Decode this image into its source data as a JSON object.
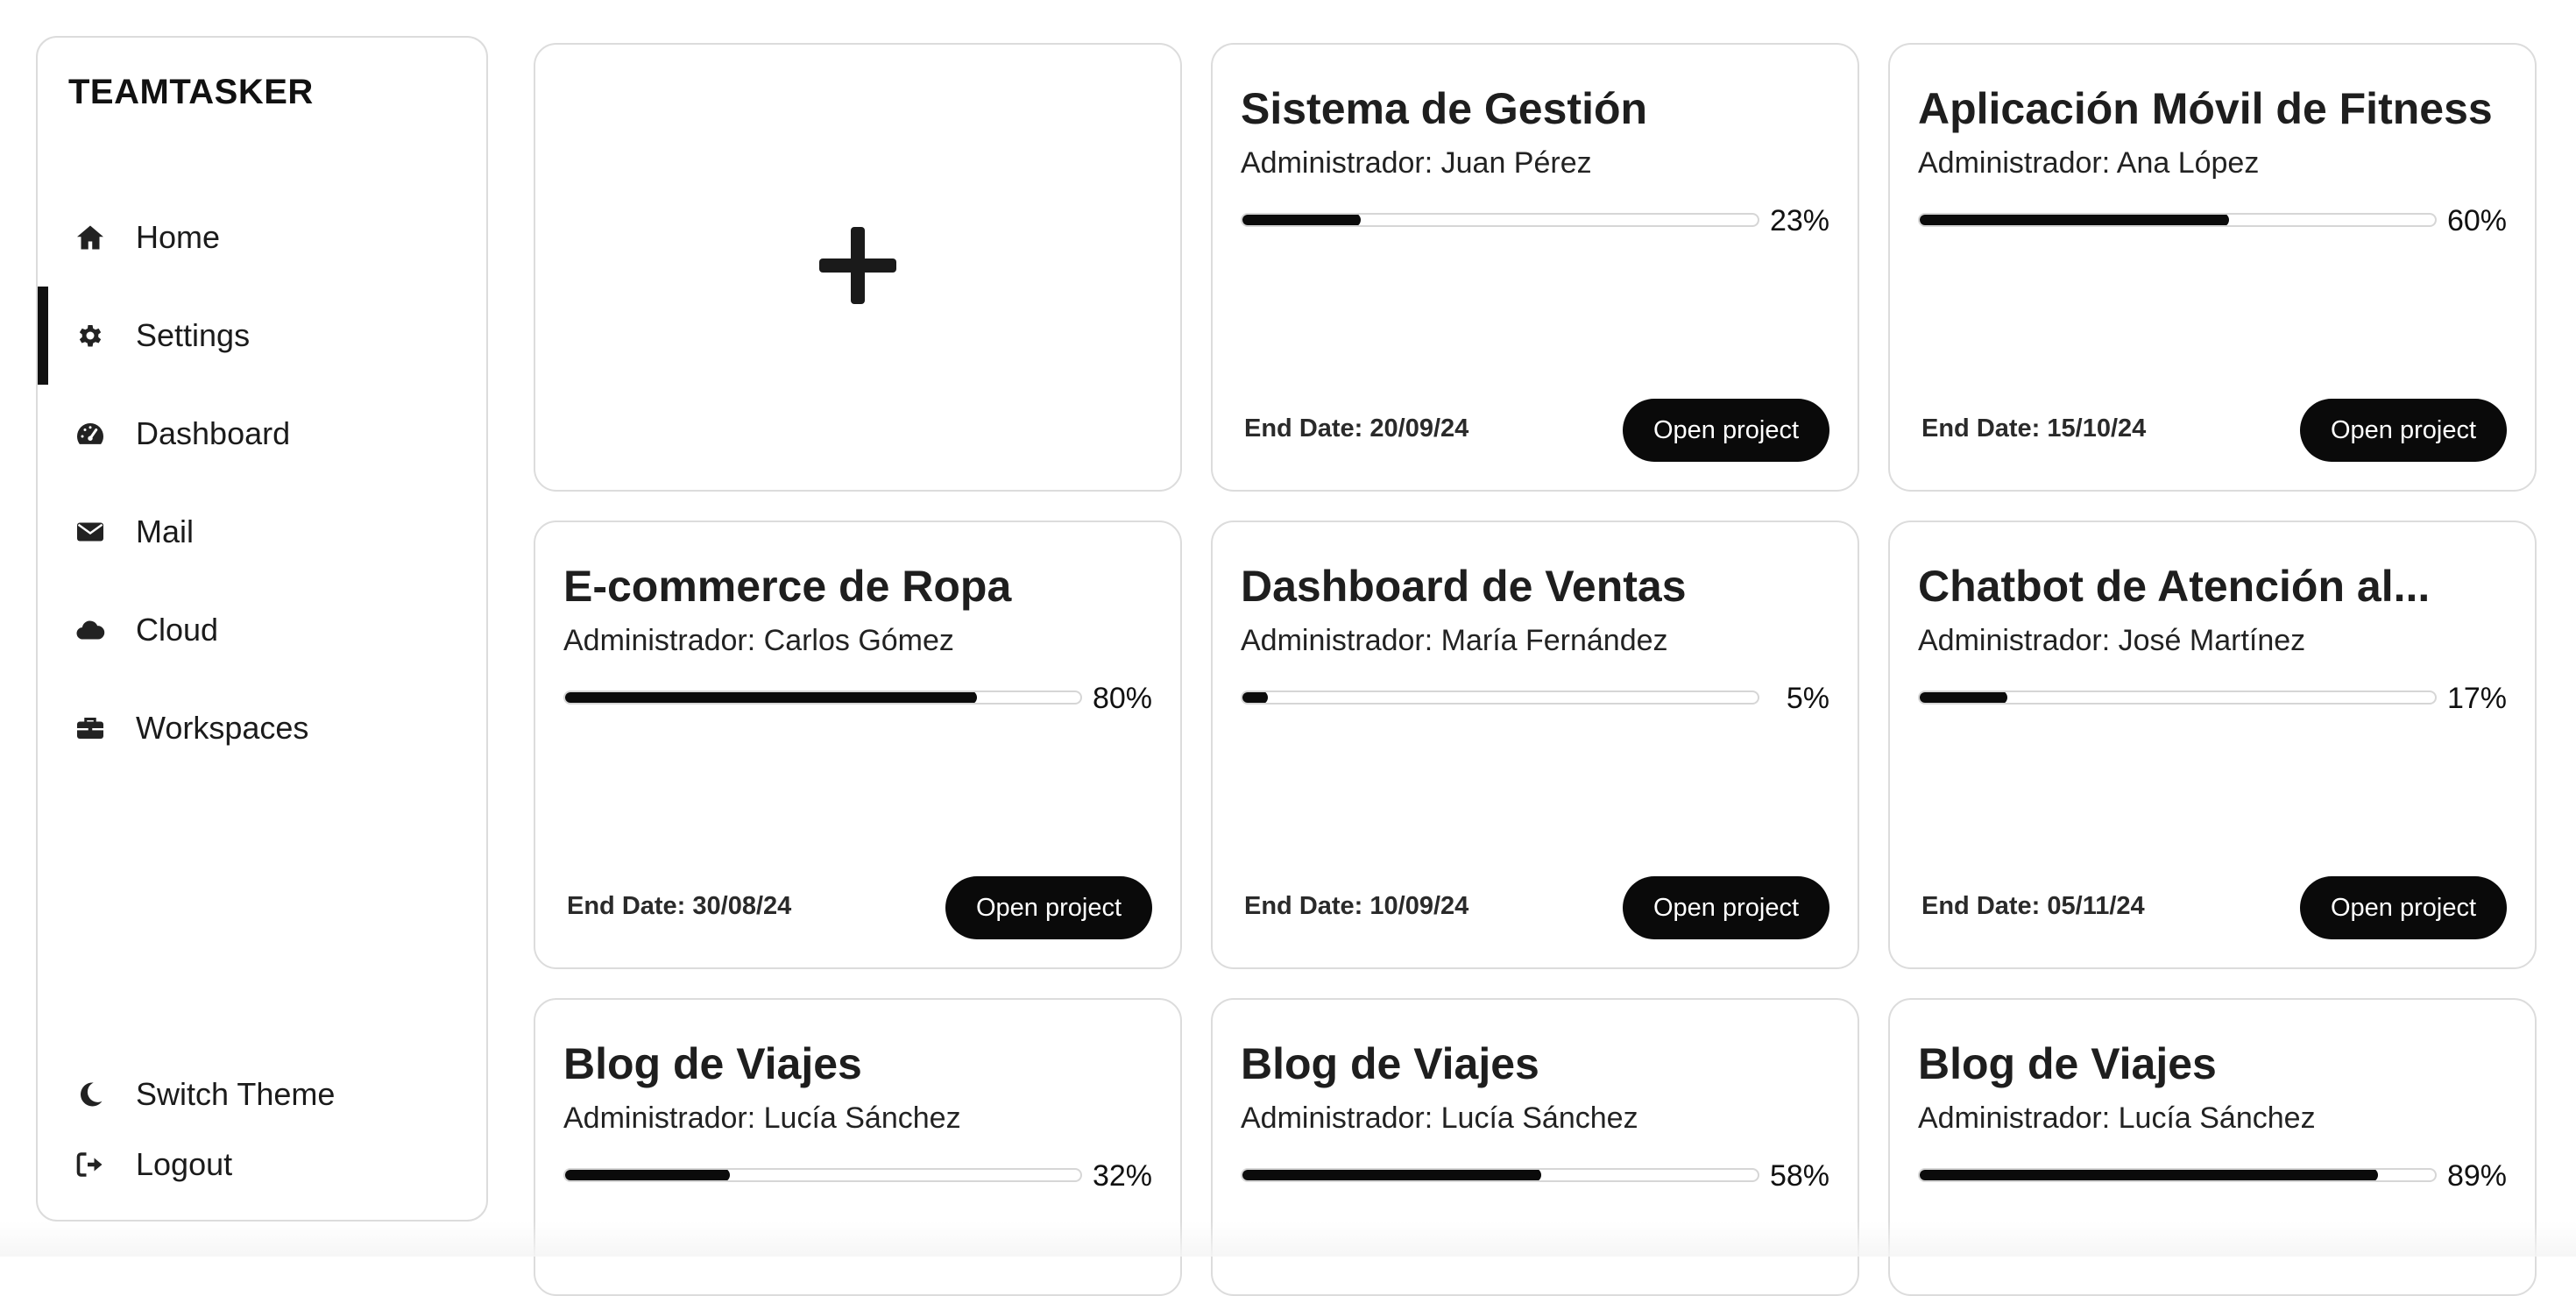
{
  "app": {
    "brand": "TEAMTASKER"
  },
  "sidebar": {
    "items": [
      {
        "label": "Home",
        "icon": "home-icon"
      },
      {
        "label": "Settings",
        "icon": "gear-icon",
        "active": true
      },
      {
        "label": "Dashboard",
        "icon": "gauge-icon"
      },
      {
        "label": "Mail",
        "icon": "envelope-icon"
      },
      {
        "label": "Cloud",
        "icon": "cloud-icon"
      },
      {
        "label": "Workspaces",
        "icon": "briefcase-icon"
      }
    ],
    "bottom": [
      {
        "label": "Switch Theme",
        "icon": "moon-icon"
      },
      {
        "label": "Logout",
        "icon": "logout-icon"
      }
    ]
  },
  "add_card": {
    "icon": "plus-icon"
  },
  "projects": [
    {
      "title": "Sistema de Gestión",
      "admin": "Administrador: Juan Pérez",
      "progress": 23,
      "progress_label": "23%",
      "end_date": "End Date: 20/09/24",
      "button": "Open project"
    },
    {
      "title": "Aplicación Móvil de Fitness",
      "admin": "Administrador: Ana López",
      "progress": 60,
      "progress_label": "60%",
      "end_date": "End Date: 15/10/24",
      "button": "Open project"
    },
    {
      "title": "E-commerce de Ropa",
      "admin": "Administrador: Carlos Gómez",
      "progress": 80,
      "progress_label": "80%",
      "end_date": "End Date: 30/08/24",
      "button": "Open project"
    },
    {
      "title": "Dashboard de Ventas",
      "admin": "Administrador: María Fernández",
      "progress": 5,
      "progress_label": "5%",
      "end_date": "End Date: 10/09/24",
      "button": "Open project"
    },
    {
      "title": "Chatbot de Atención al...",
      "admin": "Administrador: José Martínez",
      "progress": 17,
      "progress_label": "17%",
      "end_date": "End Date: 05/11/24",
      "button": "Open project"
    },
    {
      "title": "Blog de Viajes",
      "admin": "Administrador: Lucía Sánchez",
      "progress": 32,
      "progress_label": "32%",
      "end_date": "",
      "button": ""
    },
    {
      "title": "Blog de Viajes",
      "admin": "Administrador: Lucía Sánchez",
      "progress": 58,
      "progress_label": "58%",
      "end_date": "",
      "button": ""
    },
    {
      "title": "Blog de Viajes",
      "admin": "Administrador: Lucía Sánchez",
      "progress": 89,
      "progress_label": "89%",
      "end_date": "",
      "button": ""
    }
  ]
}
